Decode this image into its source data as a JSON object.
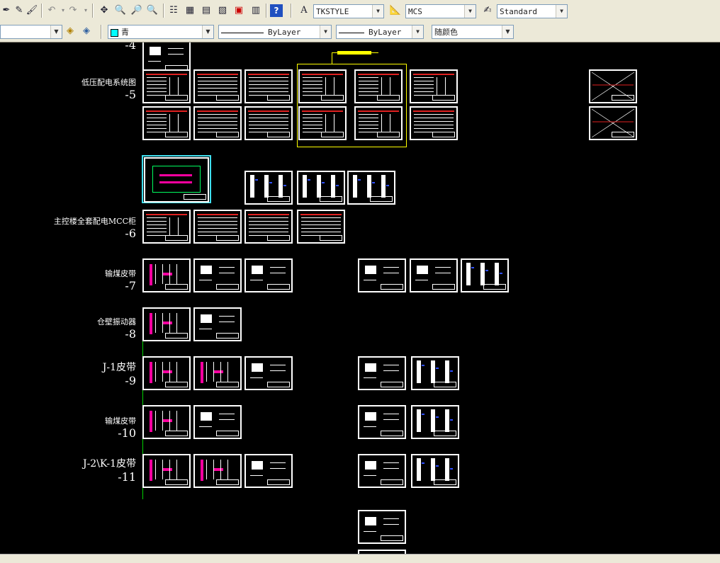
{
  "toolbar1": {
    "text_style": "TKSTYLE",
    "dim_style": "MCS",
    "table_style": "Standard"
  },
  "toolbar2": {
    "color": "青",
    "linetype": "ByLayer",
    "lineweight": "ByLayer",
    "plotstyle": "随颜色"
  },
  "colors": {
    "cyan_swatch": "#00ffff",
    "selection": "#ffff00",
    "highlight": "#40e0f0"
  },
  "groups": [
    {
      "title": "",
      "number": "-4"
    },
    {
      "title": "低压配电系统图",
      "number": "-5"
    },
    {
      "title": "主控楼全套配电MCC柜",
      "number": "-6"
    },
    {
      "title": "输煤皮带",
      "number": "-7"
    },
    {
      "title": "仓壁振动器",
      "number": "-8"
    },
    {
      "title": "J-1皮带",
      "number": "-9"
    },
    {
      "title": "输煤皮带",
      "number": "-10"
    },
    {
      "title": "J-2\\K-1皮带",
      "number": "-11"
    }
  ]
}
